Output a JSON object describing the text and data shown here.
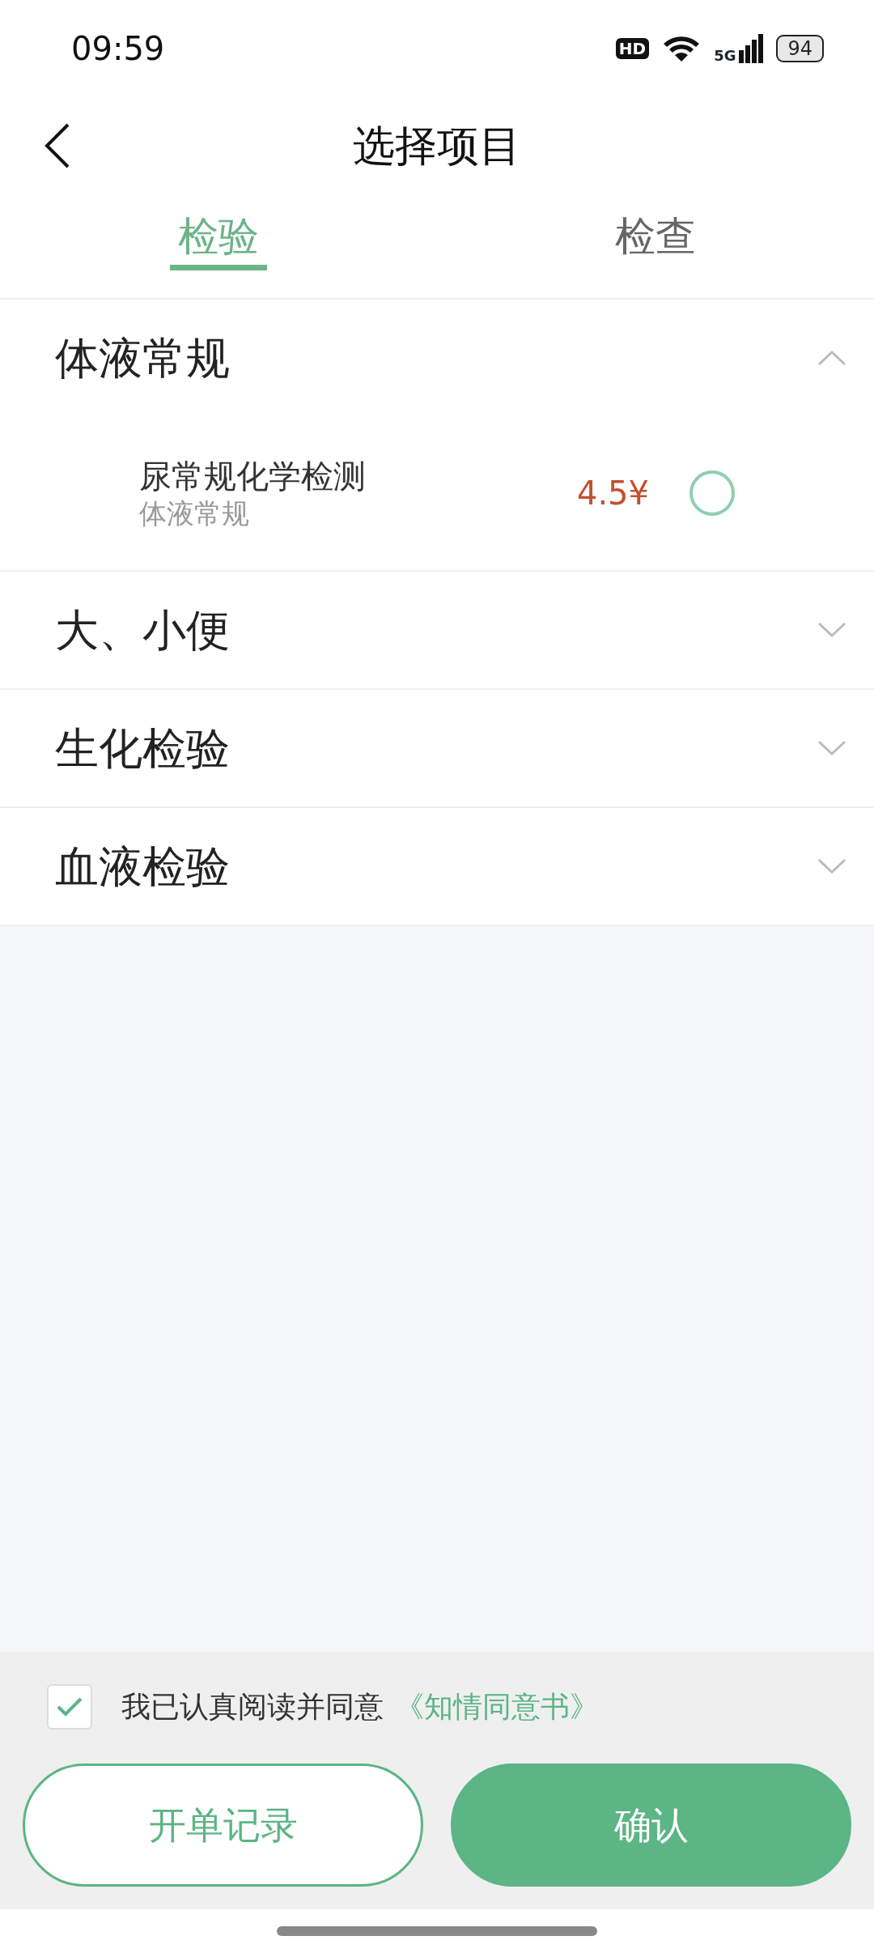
{
  "status_bar": {
    "time": "09:59",
    "hd": "HD",
    "network": "5G",
    "battery": "94"
  },
  "header": {
    "title": "选择项目"
  },
  "tabs": [
    {
      "label": "检验",
      "selected": true
    },
    {
      "label": "检查",
      "selected": false
    }
  ],
  "sections": [
    {
      "title": "体液常规",
      "expanded": true,
      "items": [
        {
          "name": "尿常规化学检测",
          "category": "体液常规",
          "price": "4.5¥",
          "selected": false
        }
      ]
    },
    {
      "title": "大、小便",
      "expanded": false
    },
    {
      "title": "生化检验",
      "expanded": false
    },
    {
      "title": "血液检验",
      "expanded": false
    }
  ],
  "consent": {
    "checked": true,
    "text": "我已认真阅读并同意",
    "link": "《知情同意书》"
  },
  "buttons": [
    {
      "label": "开单记录",
      "kind": "outline"
    },
    {
      "label": "确认",
      "kind": "primary"
    }
  ]
}
